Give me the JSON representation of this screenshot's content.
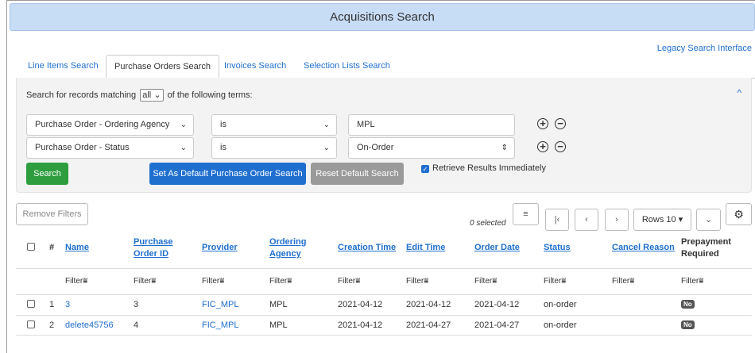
{
  "banner": {
    "title": "Acquisitions Search"
  },
  "legacy_link": "Legacy Search Interface",
  "tabs": [
    {
      "label": "Line Items Search"
    },
    {
      "label": "Purchase Orders Search"
    },
    {
      "label": "Invoices Search"
    },
    {
      "label": "Selection Lists Search"
    }
  ],
  "search": {
    "match_prefix": "Search for records matching",
    "match_value": "all",
    "match_suffix": "of the following terms:",
    "rows": [
      {
        "field": "Purchase Order - Ordering Agency",
        "op": "is",
        "value": "MPL"
      },
      {
        "field": "Purchase Order - Status",
        "op": "is",
        "value": "On-Order"
      }
    ],
    "search_btn": "Search",
    "default_btn": "Set As Default Purchase Order Search",
    "reset_btn": "Reset Default Search",
    "retrieve_label": "Retrieve Results Immediately"
  },
  "grid_toolbar": {
    "remove_filters": "Remove Filters",
    "selected": "0 selected",
    "rows_label": "Rows 10"
  },
  "columns": [
    {
      "label": "#"
    },
    {
      "label": "Name"
    },
    {
      "label": "Purchase Order ID"
    },
    {
      "label": "Provider"
    },
    {
      "label": "Ordering Agency"
    },
    {
      "label": "Creation Time"
    },
    {
      "label": "Edit Time"
    },
    {
      "label": "Order Date"
    },
    {
      "label": "Status"
    },
    {
      "label": "Cancel Reason"
    },
    {
      "label": "Prepayment Required"
    }
  ],
  "filter_label": "Filter",
  "rows": [
    {
      "num": "1",
      "name": "3",
      "po_id": "3",
      "provider": "FIC_MPL",
      "agency": "MPL",
      "created": "2021-04-12",
      "edited": "2021-04-12",
      "order_date": "2021-04-12",
      "status": "on-order",
      "cancel": "",
      "prepay": "No"
    },
    {
      "num": "2",
      "name": "delete45756",
      "po_id": "4",
      "provider": "FIC_MPL",
      "agency": "MPL",
      "created": "2021-04-12",
      "edited": "2021-04-27",
      "order_date": "2021-04-27",
      "status": "on-order",
      "cancel": "",
      "prepay": "No"
    }
  ]
}
